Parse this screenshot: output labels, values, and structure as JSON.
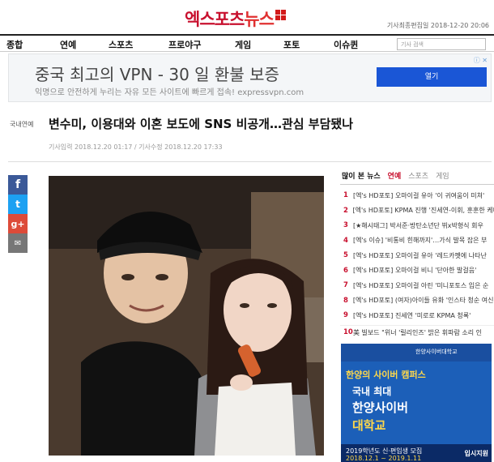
{
  "logo": {
    "part1": "엑스포츠",
    "part2": "뉴스"
  },
  "edit_date": "기사최종편집일 2018-12-20 20:06",
  "nav": {
    "items": [
      "종합",
      "연예",
      "스포츠",
      "프로야구",
      "게임",
      "포토",
      "이슈퀸"
    ],
    "search_placeholder": "기사 검색"
  },
  "ad": {
    "title": "중국 최고의 VPN - 30 일 환불 보증",
    "subtitle": "익명으로 안전하게 누리는 자유 모든 사이트에 빠르게 접속! expressvpn.com",
    "button": "열기",
    "marker": "ⓘ ✕"
  },
  "article": {
    "section": "국내연예",
    "headline": "변수미, 이용대와 이혼 보도에 SNS 비공개…관심 부담됐나",
    "dates": "기사입력 2018.12.20 01:17 / 기사수정 2018.12.20 17:33"
  },
  "share": {
    "facebook": "f",
    "twitter": "t",
    "google": "g+",
    "email": "✉"
  },
  "popular": {
    "title": "많이 본 뉴스",
    "tabs": [
      "연예",
      "스포츠",
      "게임"
    ],
    "active_tab": "연예",
    "items": [
      {
        "num": "1",
        "text": "[엑's HD포토] 오마이걸 유아 '이 귀여움이 미쳐'"
      },
      {
        "num": "2",
        "text": "[엑's HD포토] KPMA 진행 '진세연-이휘, 훈훈한 케미'"
      },
      {
        "num": "3",
        "text": "[★해시태그] 박서준·방탄소년단 뷔x박형식 회우"
      },
      {
        "num": "4",
        "text": "[엑's 이슈] '비통비 힌해까지'…가식 발목 잡은 부"
      },
      {
        "num": "5",
        "text": "[엑's HD포토] 오마이걸 유아 '레드카펫에 나타난"
      },
      {
        "num": "6",
        "text": "[엑's HD포토] 오마이걸 비니 '단아한 발걸음'"
      },
      {
        "num": "7",
        "text": "[엑's HD포토] 오마이걸 아린 '미니포토스 입은 순"
      },
      {
        "num": "8",
        "text": "[엑's HD포토] (여자)아이들 유화 '인스타 청순 여신'"
      },
      {
        "num": "9",
        "text": "[엑's HD포토] 진세연 '미로로 KPMA 청록'"
      },
      {
        "num": "10",
        "text": "美 빌보드 \"위너 '릴리인즈' 밝은 휘파람 소리 인"
      }
    ]
  },
  "banner": {
    "school": "한양사이버대학교",
    "line1": "한양의 사이버 캠퍼스",
    "line2": "국내 최대",
    "line3": "한양사이버",
    "line4": "대학교",
    "line5": "2019학년도 신·편입생 모집",
    "line6": "2018.12.1 ~ 2019.1.11",
    "line7": "입시지원"
  }
}
